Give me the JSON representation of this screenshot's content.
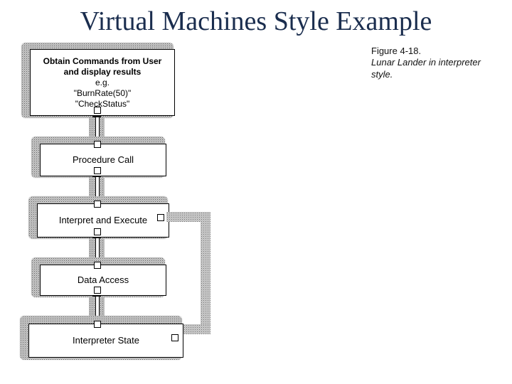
{
  "title": "Virtual Machines Style Example",
  "caption": {
    "fig": "Figure 4-18.",
    "desc": "Lunar Lander in interpreter style."
  },
  "nodes": {
    "n1": {
      "lines": [
        "Obtain Commands from User",
        "and display results",
        "e.g.",
        "\"BurnRate(50)\"",
        "\"CheckStatus\""
      ]
    },
    "n2": {
      "label": "Procedure Call"
    },
    "n3": {
      "label": "Interpret and Execute"
    },
    "n4": {
      "label": "Data Access"
    },
    "n5": {
      "label": "Interpreter State"
    }
  }
}
